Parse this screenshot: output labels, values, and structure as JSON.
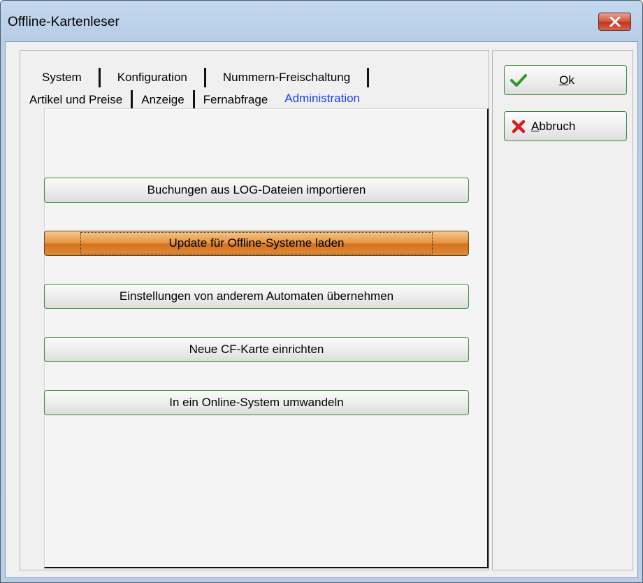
{
  "window": {
    "title": "Offline-Kartenleser"
  },
  "tabs": {
    "back_row": [
      "System",
      "Konfiguration",
      "Nummern-Freischaltung"
    ],
    "front_row": [
      "Artikel und Preise",
      "Anzeige",
      "Fernabfrage",
      "Administration"
    ],
    "active": "Administration"
  },
  "actions": [
    {
      "label": "Buchungen aus LOG-Dateien importieren"
    },
    {
      "label": "Update für Offline-Systeme laden",
      "highlighted": true
    },
    {
      "label": "Einstellungen von anderem Automaten übernehmen"
    },
    {
      "label": "Neue CF-Karte einrichten"
    },
    {
      "label": "In ein Online-System umwandeln"
    }
  ],
  "side": {
    "ok": {
      "label_first": "O",
      "label_rest": "k",
      "icon": "checkmark-icon",
      "icon_color": "#2a9a2a"
    },
    "cancel": {
      "label_first": "A",
      "label_rest": "bbruch",
      "icon": "x-icon",
      "icon_color": "#d81e1e"
    }
  },
  "colors": {
    "accent_tab": "#1a3cff",
    "highlight": "#e8913c",
    "button_border": "#3a8a3a"
  }
}
